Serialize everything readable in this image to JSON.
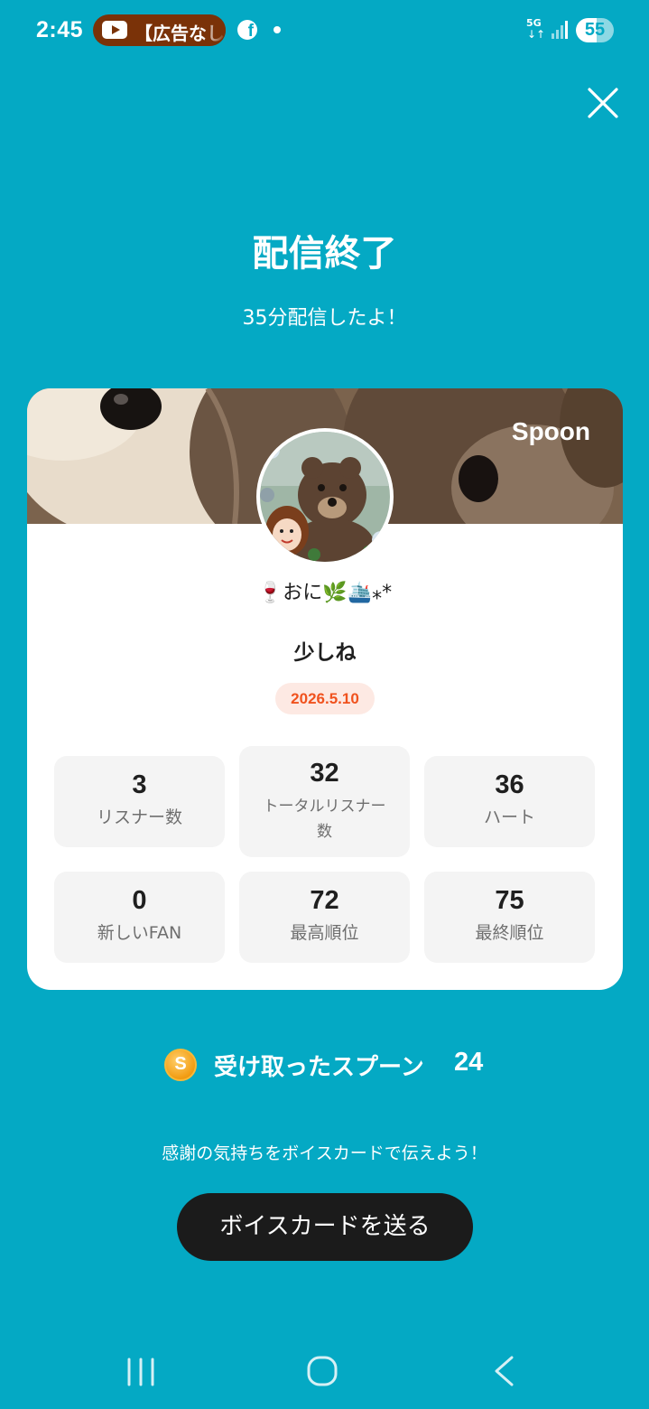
{
  "status_bar": {
    "time": "2:45",
    "notification_text": "【広告なし",
    "facebook_glyph": "f",
    "network_label": "5G",
    "network_arrows": "↓↑",
    "battery_percent": "55",
    "battery_level": 0.55,
    "icons": [
      "youtube-icon",
      "facebook-icon",
      "dot-icon",
      "signal-icon",
      "battery-icon"
    ]
  },
  "header": {
    "title": "配信終了",
    "subtitle": "35分配信したよ！"
  },
  "card": {
    "brand": "Spoon",
    "dj_name": "🍷おに🌿🛳️⁎*",
    "cast_title": "少しね",
    "date": "2026.5.10",
    "stats": [
      {
        "value": "3",
        "label": "リスナー数"
      },
      {
        "value": "32",
        "label": "トータルリスナー数"
      },
      {
        "value": "36",
        "label": "ハート"
      },
      {
        "value": "0",
        "label": "新しいFAN"
      },
      {
        "value": "72",
        "label": "最高順位"
      },
      {
        "value": "75",
        "label": "最終順位"
      }
    ]
  },
  "spoons": {
    "coin_glyph": "S",
    "label": "受け取ったスプーン",
    "count": "24"
  },
  "voice_card": {
    "prompt": "感謝の気持ちをボイスカードで伝えよう！",
    "button_label": "ボイスカードを送る"
  },
  "colors": {
    "background": "#04a9c4",
    "button": "#1b1b1b",
    "date_badge_text": "#f0521e",
    "date_badge_bg": "#fde9e3",
    "stat_bg": "#f4f4f4"
  }
}
